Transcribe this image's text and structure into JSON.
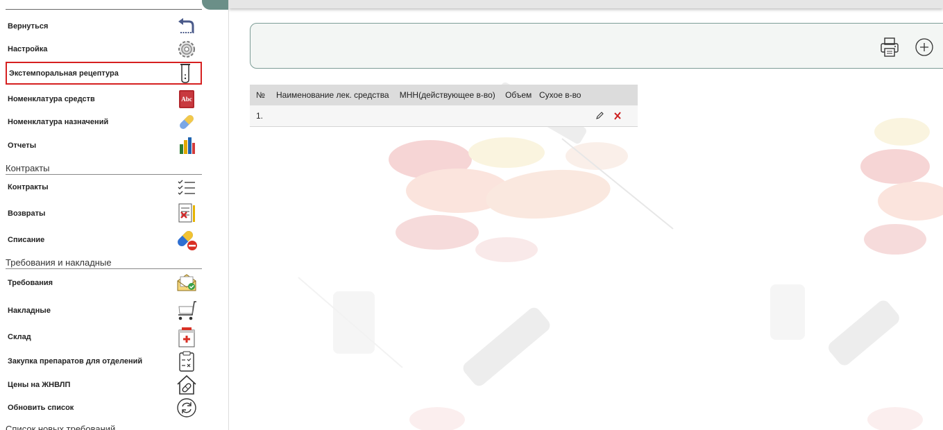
{
  "sidebar": {
    "items": [
      {
        "label": "Вернуться",
        "icon": "back-arrow-icon"
      },
      {
        "label": "Настройка",
        "icon": "gear-icon"
      },
      {
        "label": "Экстемпоральная рецептура",
        "icon": "test-tube-icon",
        "selected": true
      },
      {
        "label": "Номенклатура средств",
        "icon": "dictionary-book-icon"
      },
      {
        "label": "Номенклатура назначений",
        "icon": "pill-capsule-icon"
      },
      {
        "label": "Отчеты",
        "icon": "bar-chart-icon"
      }
    ],
    "sections": [
      {
        "title": "Контракты",
        "items": [
          {
            "label": "Контракты",
            "icon": "checklist-icon"
          },
          {
            "label": "Возвраты",
            "icon": "return-document-icon"
          },
          {
            "label": "Списание",
            "icon": "pill-remove-icon"
          }
        ]
      },
      {
        "title": "Требования и накладные",
        "items": [
          {
            "label": "Требования",
            "icon": "envelope-request-icon"
          },
          {
            "label": "Накладные",
            "icon": "cart-icon"
          },
          {
            "label": "Склад",
            "icon": "medical-box-icon"
          },
          {
            "label": "Закупка препаратов для отделений",
            "icon": "clipboard-check-icon"
          },
          {
            "label": "Цены на ЖНВЛП",
            "icon": "house-pill-icon"
          },
          {
            "label": "Обновить список",
            "icon": "refresh-icon"
          }
        ]
      },
      {
        "title": "Список новых требований",
        "items": []
      }
    ]
  },
  "toolbar": {
    "print_icon": "printer-icon",
    "add_icon": "add-circle-icon"
  },
  "table": {
    "columns": [
      "№",
      "Наименование лек. средства",
      "МНН(действующее в-во)",
      "Объем",
      "Сухое в-во"
    ],
    "rows": [
      {
        "num": "1.",
        "name": "",
        "inn": "",
        "volume": "",
        "dry": ""
      }
    ]
  },
  "colors": {
    "accent": "#7c9c95",
    "selected_border": "#d62020",
    "delete": "#cc1f1f",
    "header_bg": "#dcdcdc"
  }
}
